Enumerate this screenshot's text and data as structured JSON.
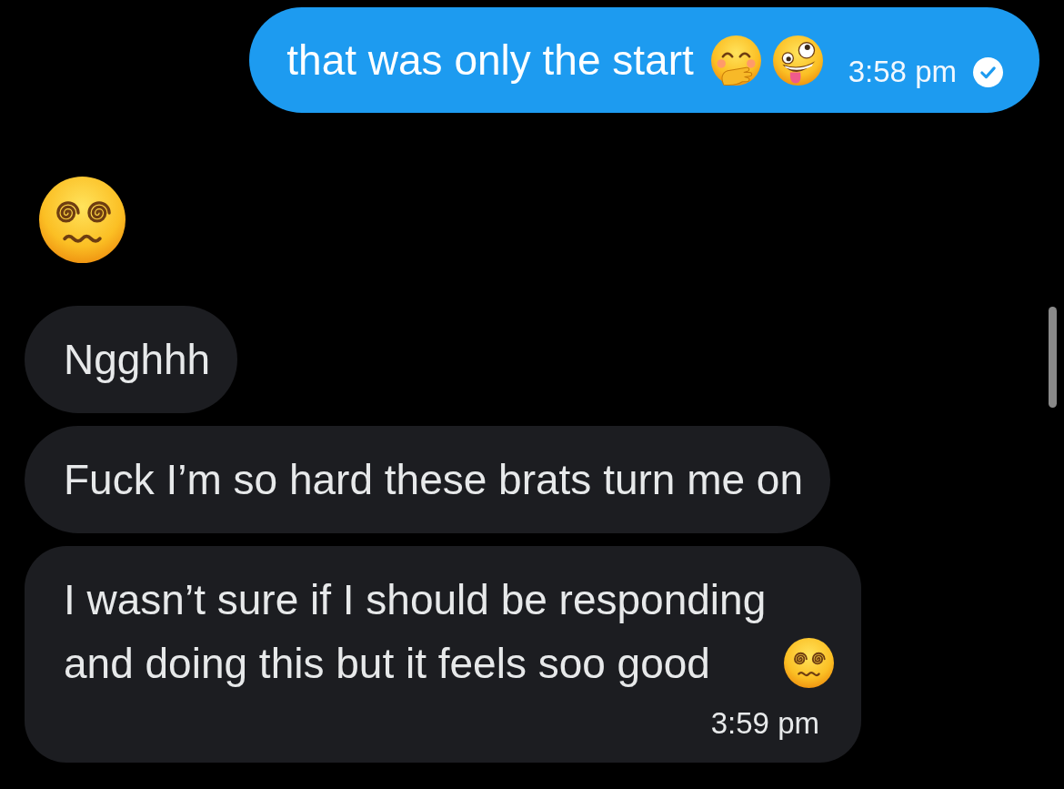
{
  "messages": [
    {
      "kind": "text",
      "outgoing": true,
      "text": "that was only the start",
      "emojis": [
        {
          "kind": "hand-over-mouth"
        },
        {
          "kind": "zany"
        }
      ],
      "time": "3:58 pm",
      "seen": true
    },
    {
      "kind": "emoji",
      "outgoing": false,
      "emojis": [
        {
          "kind": "spiral-eyes"
        }
      ]
    },
    {
      "kind": "text",
      "outgoing": false,
      "text": "Ngghhh"
    },
    {
      "kind": "text",
      "outgoing": false,
      "text": "Fuck I’m so hard these brats turn me on"
    },
    {
      "kind": "text",
      "outgoing": false,
      "text": "I wasn’t sure if I should be responding and doing this but it feels soo good",
      "emojis": [
        {
          "kind": "spiral-eyes"
        }
      ],
      "time": "3:59 pm"
    }
  ]
}
